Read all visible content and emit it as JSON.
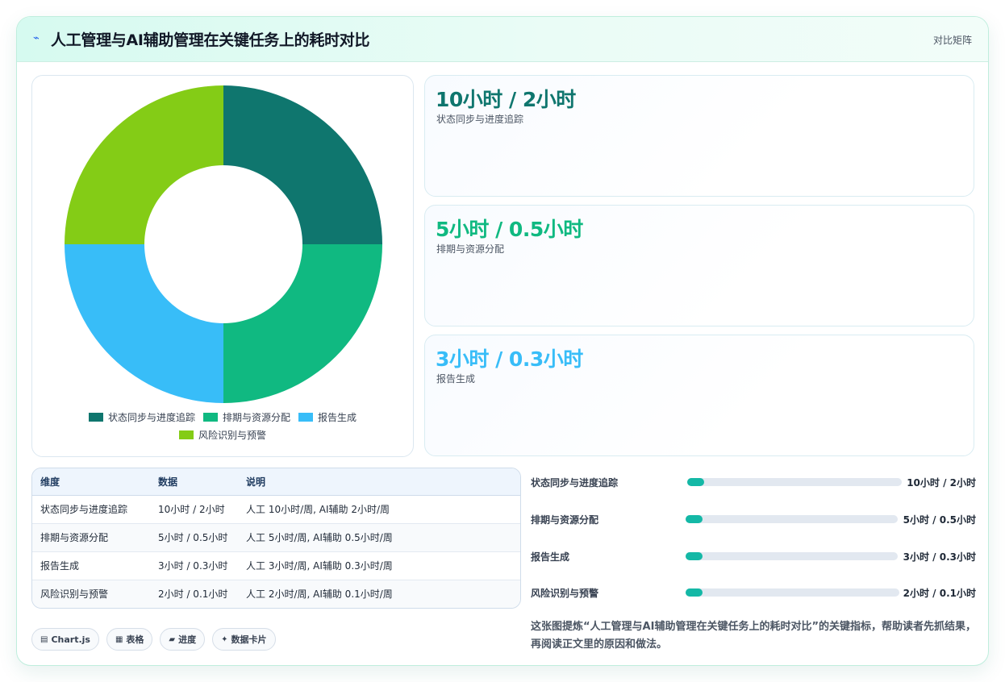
{
  "header": {
    "logo_icon": "⌁",
    "title": "人工管理与AI辅助管理在关键任务上的耗时对比",
    "tag": "对比矩阵"
  },
  "chart_data": {
    "type": "doughnut",
    "categories": [
      "状态同步与进度追踪",
      "排期与资源分配",
      "报告生成",
      "风险识别与预警"
    ],
    "values": [
      1,
      1,
      1,
      1
    ],
    "colors": [
      "#0f766e",
      "#10b981",
      "#38bdf8",
      "#84cc16"
    ],
    "legend": "bottom"
  },
  "stats": [
    {
      "value": "10小时 / 2小时",
      "label": "状态同步与进度追踪",
      "color": "#0f766e"
    },
    {
      "value": "5小时 / 0.5小时",
      "label": "排期与资源分配",
      "color": "#10b981"
    },
    {
      "value": "3小时 / 0.3小时",
      "label": "报告生成",
      "color": "#38bdf8"
    }
  ],
  "table": {
    "headers": [
      "维度",
      "数据",
      "说明"
    ],
    "rows": [
      [
        "状态同步与进度追踪",
        "10小时 / 2小时",
        "人工 10小时/周, AI辅助 2小时/周"
      ],
      [
        "排期与资源分配",
        "5小时 / 0.5小时",
        "人工 5小时/周, AI辅助 0.5小时/周"
      ],
      [
        "报告生成",
        "3小时 / 0.3小时",
        "人工 3小时/周, AI辅助 0.3小时/周"
      ],
      [
        "风险识别与预警",
        "2小时 / 0.1小时",
        "人工 2小时/周, AI辅助 0.1小时/周"
      ]
    ]
  },
  "progress": [
    {
      "label": "状态同步与进度追踪",
      "value": "10小时 / 2小时",
      "fraction": 0.08
    },
    {
      "label": "排期与资源分配",
      "value": "5小时 / 0.5小时",
      "fraction": 0.08
    },
    {
      "label": "报告生成",
      "value": "3小时 / 0.3小时",
      "fraction": 0.08
    },
    {
      "label": "风险识别与预警",
      "value": "2小时 / 0.1小时",
      "fraction": 0.08
    }
  ],
  "pills": [
    {
      "icon": "▤",
      "label": "Chart.js"
    },
    {
      "icon": "▦",
      "label": "表格"
    },
    {
      "icon": "▰",
      "label": "进度"
    },
    {
      "icon": "✦",
      "label": "数据卡片"
    }
  ],
  "note": "这张图提炼“人工管理与AI辅助管理在关键任务上的耗时对比”的关键指标，帮助读者先抓结果，再阅读正文里的原因和做法。"
}
